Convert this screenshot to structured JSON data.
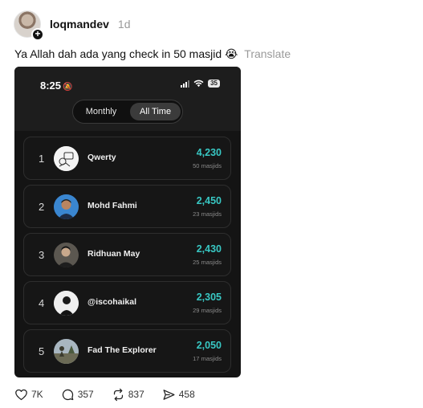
{
  "post": {
    "username": "loqmandev",
    "time_ago": "1d",
    "text": "Ya Allah dah ada yang check in 50 masjid",
    "emoji": "😭",
    "translate_label": "Translate"
  },
  "screenshot": {
    "status_time": "8:25",
    "battery": "35",
    "toggle": {
      "monthly": "Monthly",
      "all_time": "All Time",
      "selected": "All Time"
    },
    "leaderboard": [
      {
        "rank": "1",
        "name": "Qwerty",
        "score": "4,230",
        "sub": "50 masjids"
      },
      {
        "rank": "2",
        "name": "Mohd Fahmi",
        "score": "2,450",
        "sub": "23 masjids"
      },
      {
        "rank": "3",
        "name": "Ridhuan May",
        "score": "2,430",
        "sub": "25 masjids"
      },
      {
        "rank": "4",
        "name": "@iscohaikal",
        "score": "2,305",
        "sub": "29 masjids"
      },
      {
        "rank": "5",
        "name": "Fad The Explorer",
        "score": "2,050",
        "sub": "17 masjids"
      }
    ]
  },
  "actions": {
    "likes": "7K",
    "comments": "357",
    "reposts": "837",
    "shares": "458"
  },
  "colors": {
    "accent": "#38c7c3",
    "panel": "#141414"
  }
}
